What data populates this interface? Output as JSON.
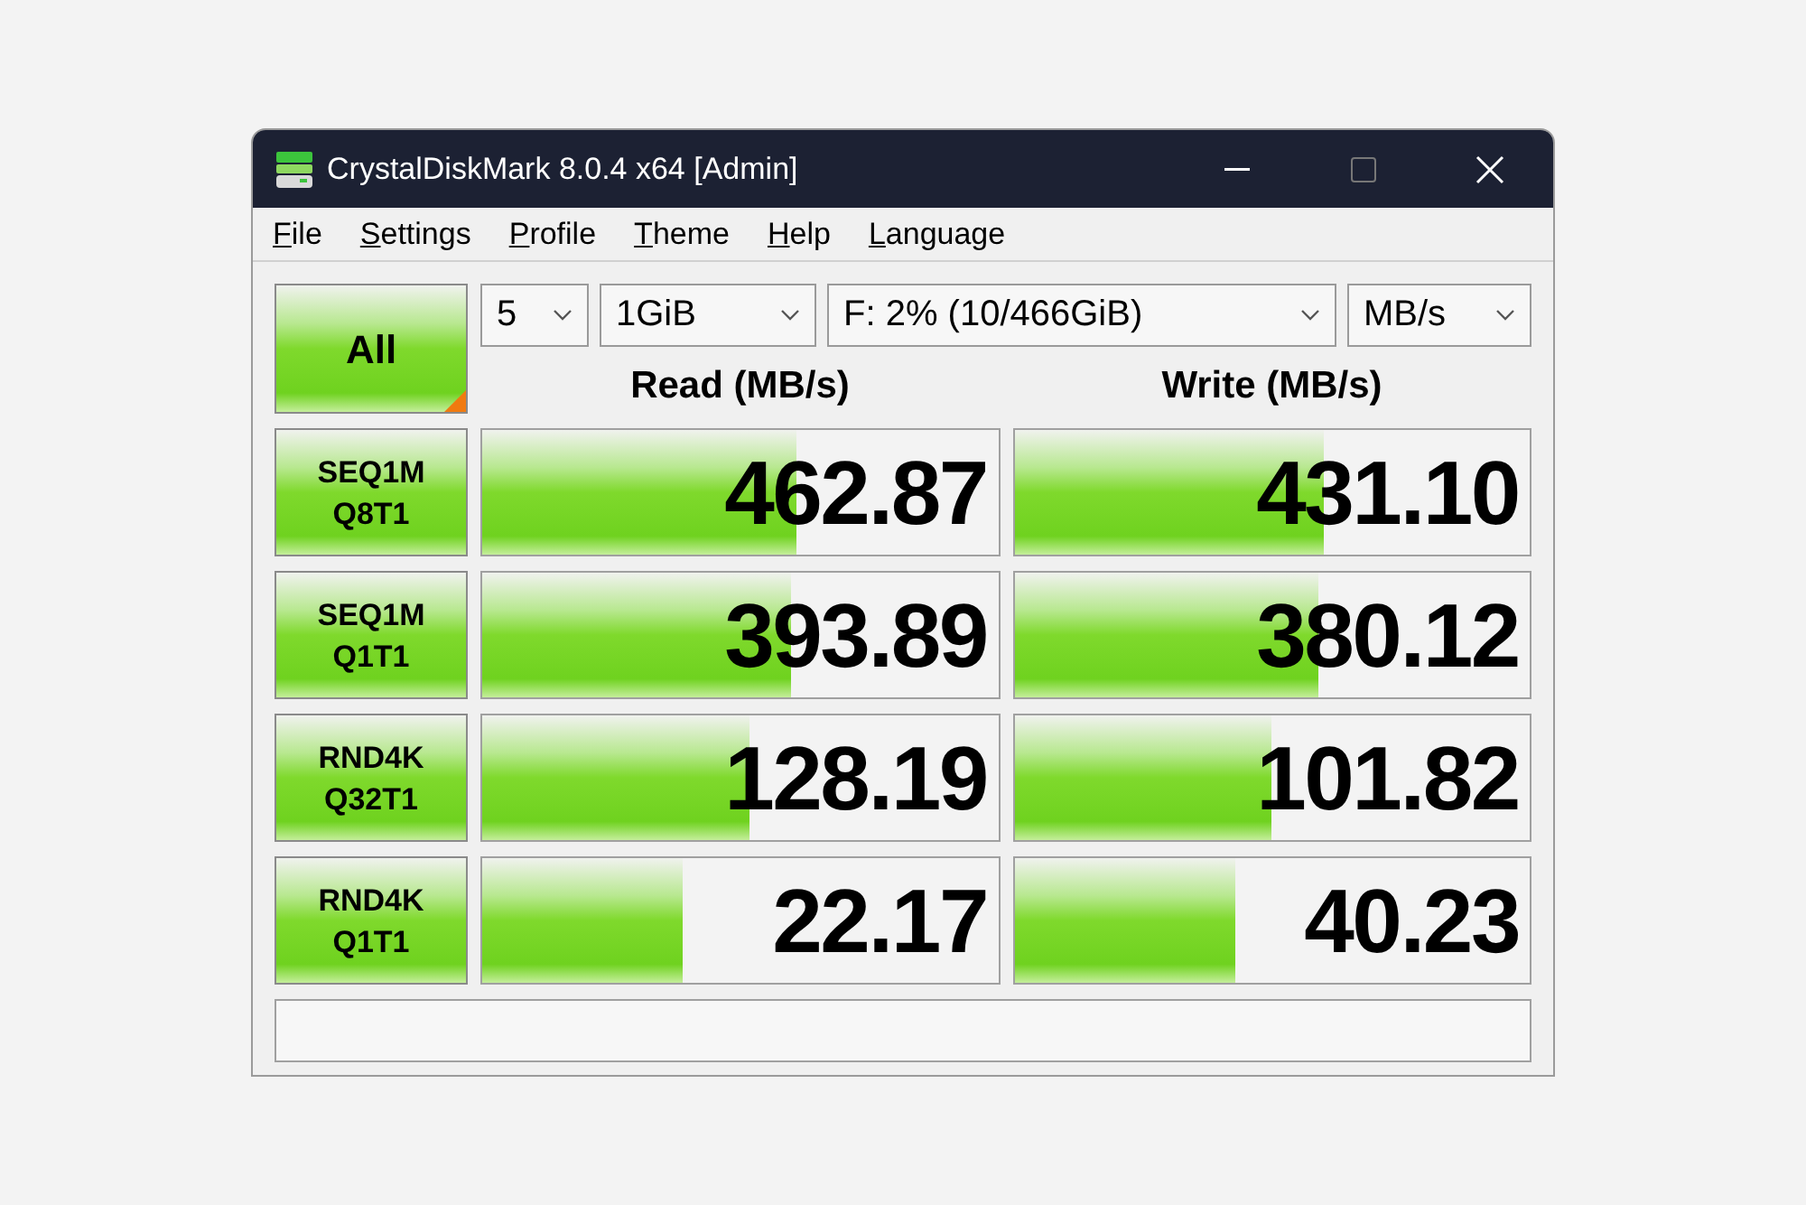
{
  "window": {
    "title": "CrystalDiskMark 8.0.4 x64 [Admin]"
  },
  "menu": [
    "File",
    "Settings",
    "Profile",
    "Theme",
    "Help",
    "Language"
  ],
  "all_button": {
    "label": "All"
  },
  "selectors": [
    {
      "value": "5"
    },
    {
      "value": "1GiB"
    },
    {
      "value": "F: 2% (10/466GiB)"
    },
    {
      "value": "MB/s"
    }
  ],
  "headers": {
    "read": "Read (MB/s)",
    "write": "Write (MB/s)"
  },
  "tests": [
    {
      "line1": "SEQ1M",
      "line2": "Q8T1",
      "read": {
        "value": "462.87",
        "level": 0.61
      },
      "write": {
        "value": "431.10",
        "level": 0.6
      }
    },
    {
      "line1": "SEQ1M",
      "line2": "Q1T1",
      "read": {
        "value": "393.89",
        "level": 0.6
      },
      "write": {
        "value": "380.12",
        "level": 0.59
      }
    },
    {
      "line1": "RND4K",
      "line2": "Q32T1",
      "read": {
        "value": "128.19",
        "level": 0.52
      },
      "write": {
        "value": "101.82",
        "level": 0.5
      }
    },
    {
      "line1": "RND4K",
      "line2": "Q1T1",
      "read": {
        "value": "22.17",
        "level": 0.39
      },
      "write": {
        "value": "40.23",
        "level": 0.43
      }
    }
  ]
}
